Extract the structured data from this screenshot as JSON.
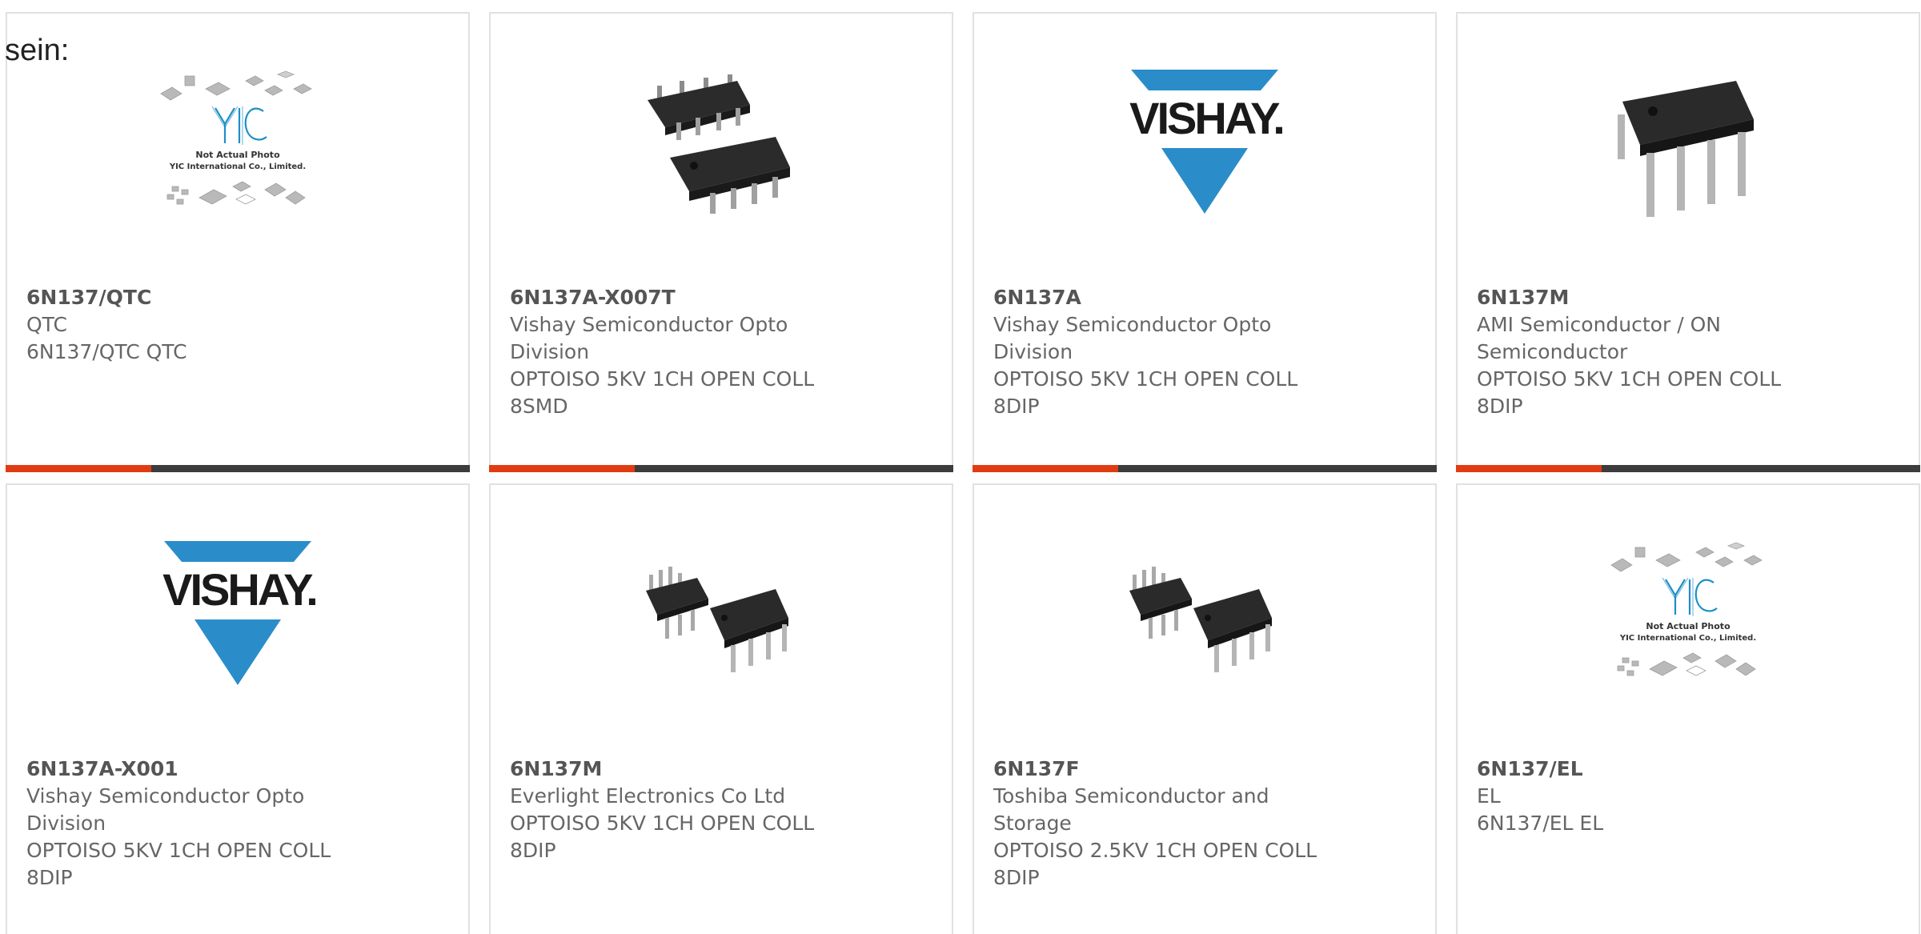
{
  "intro_text": "sein:",
  "colors": {
    "accent": "#e03c12",
    "bar": "#3c3c3c",
    "border": "#e1e1e1",
    "text": "#666666"
  },
  "placeholder_image": {
    "caption_line1": "Not Actual Photo",
    "caption_line2": "YIC International Co., Limited.",
    "logo_text": "YIC"
  },
  "vishay_logo_text": "VISHAY.",
  "products": [
    {
      "part": "6N137/QTC",
      "manufacturer": "QTC",
      "description": "6N137/QTC QTC",
      "image": "placeholder-icon"
    },
    {
      "part": "6N137A-X007T",
      "manufacturer": "Vishay Semiconductor Opto Division",
      "description": "OPTOISO 5KV 1CH OPEN COLL 8SMD",
      "image": "smd8-chip-icon"
    },
    {
      "part": "6N137A",
      "manufacturer": "Vishay Semiconductor Opto Division",
      "description": "OPTOISO 5KV 1CH OPEN COLL 8DIP",
      "image": "vishay-logo"
    },
    {
      "part": "6N137M",
      "manufacturer": "AMI Semiconductor / ON Semiconductor",
      "description": "OPTOISO 5KV 1CH OPEN COLL 8DIP",
      "image": "dip8-chip-icon"
    },
    {
      "part": "6N137A-X001",
      "manufacturer": "Vishay Semiconductor Opto Division",
      "description": "OPTOISO 5KV 1CH OPEN COLL 8DIP",
      "image": "vishay-logo"
    },
    {
      "part": "6N137M",
      "manufacturer": "Everlight Electronics Co Ltd",
      "description": "OPTOISO 5KV 1CH OPEN COLL 8DIP",
      "image": "dip8-pair-icon"
    },
    {
      "part": "6N137F",
      "manufacturer": "Toshiba Semiconductor and Storage",
      "description": "OPTOISO 2.5KV 1CH OPEN COLL 8DIP",
      "image": "dip8-pair-icon"
    },
    {
      "part": "6N137/EL",
      "manufacturer": "EL",
      "description": "6N137/EL EL",
      "image": "placeholder-icon"
    }
  ]
}
